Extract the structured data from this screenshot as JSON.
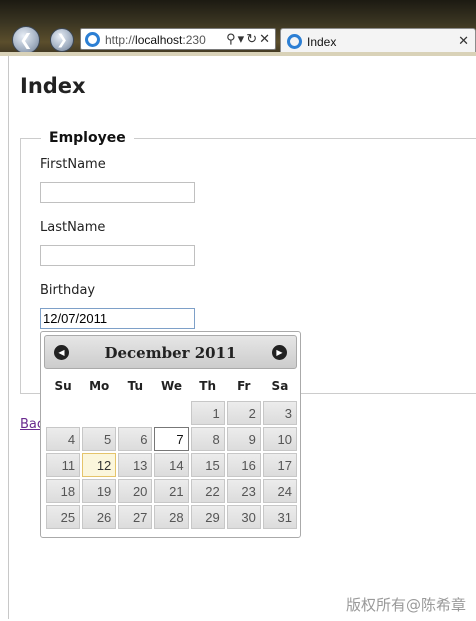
{
  "browser": {
    "url_prefix": "http://",
    "url_host": "localhost",
    "url_port": ":230",
    "tab_title": "Index",
    "icons": [
      "back-icon",
      "forward-icon",
      "ie-icon",
      "search-icon",
      "dropdown-icon",
      "refresh-icon",
      "close-icon"
    ]
  },
  "page": {
    "title": "Index",
    "legend": "Employee",
    "first_name_label": "FirstName",
    "first_name_value": "",
    "last_name_label": "LastName",
    "last_name_value": "",
    "birthday_label": "Birthday",
    "birthday_value": "12/07/2011",
    "back_link_text": "Bac"
  },
  "datepicker": {
    "month_title": "December 2011",
    "day_headers": [
      "Su",
      "Mo",
      "Tu",
      "We",
      "Th",
      "Fr",
      "Sa"
    ],
    "weeks": [
      [
        "",
        "",
        "",
        "",
        "1",
        "2",
        "3"
      ],
      [
        "4",
        "5",
        "6",
        "7",
        "8",
        "9",
        "10"
      ],
      [
        "11",
        "12",
        "13",
        "14",
        "15",
        "16",
        "17"
      ],
      [
        "18",
        "19",
        "20",
        "21",
        "22",
        "23",
        "24"
      ],
      [
        "25",
        "26",
        "27",
        "28",
        "29",
        "30",
        "31"
      ]
    ],
    "selected_day": "7",
    "today_day": "12"
  },
  "watermark": "版权所有@陈希章"
}
